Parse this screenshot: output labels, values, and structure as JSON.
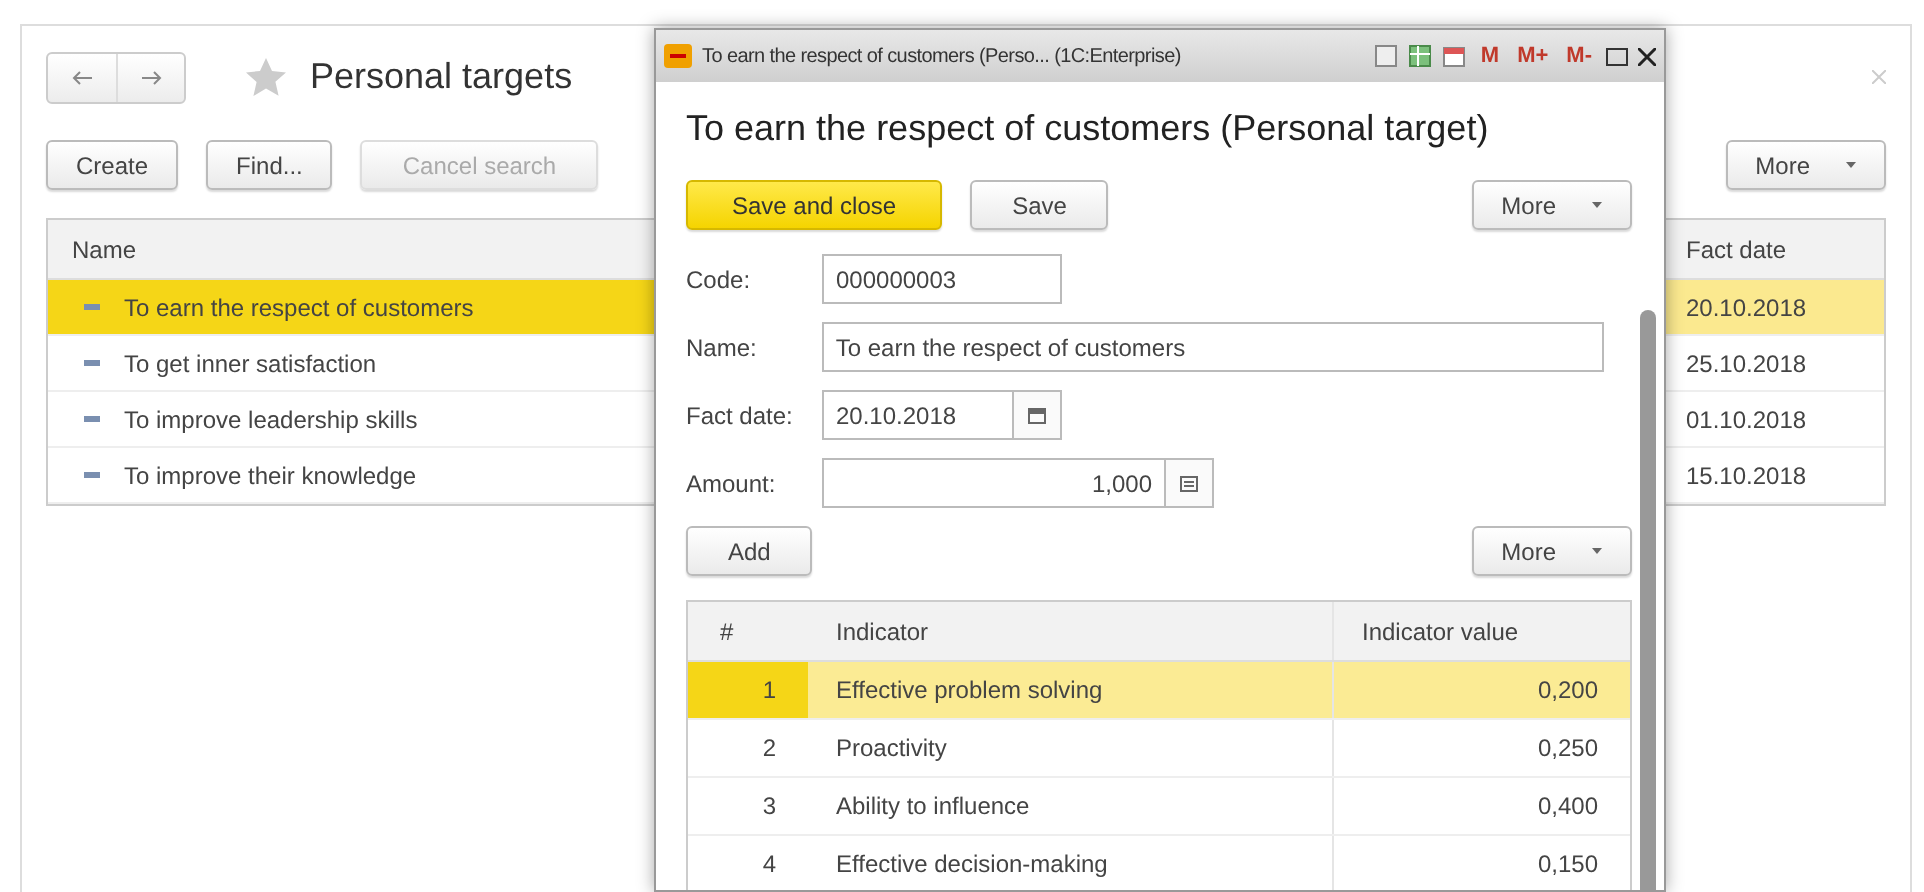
{
  "main": {
    "title": "Personal targets",
    "toolbar": [
      {
        "label": "Create",
        "disabled": false
      },
      {
        "label": "Find...",
        "disabled": false
      },
      {
        "label": "Cancel search",
        "disabled": true
      }
    ],
    "more": "More",
    "list": {
      "columns": [
        "Name",
        "Fact date"
      ],
      "rows": [
        {
          "name": "To earn the respect of customers",
          "fact_date": "20.10.2018",
          "selected": true
        },
        {
          "name": "To get inner satisfaction",
          "fact_date": "25.10.2018",
          "selected": false
        },
        {
          "name": "To improve leadership skills",
          "fact_date": "01.10.2018",
          "selected": false
        },
        {
          "name": "To improve their knowledge",
          "fact_date": "15.10.2018",
          "selected": false
        }
      ]
    }
  },
  "dialog": {
    "window_title": "To earn the respect of customers (Perso... (1C:Enterprise)",
    "memory_buttons": [
      "M",
      "M+",
      "M-"
    ],
    "heading": "To earn the respect of customers (Personal target)",
    "buttons": [
      {
        "label": "Save and close",
        "kind": "primary"
      },
      {
        "label": "Save",
        "kind": "plain"
      }
    ],
    "more": "More",
    "fields": [
      {
        "label": "Code:",
        "value": "000000003",
        "kind": "code"
      },
      {
        "label": "Name:",
        "value": "To earn the respect of customers",
        "kind": "text"
      },
      {
        "label": "Fact date:",
        "value": "20.10.2018",
        "kind": "date"
      },
      {
        "label": "Amount:",
        "value": "1,000",
        "kind": "number"
      }
    ],
    "table": {
      "add": "Add",
      "more": "More",
      "columns": [
        "#",
        "Indicator",
        "Indicator value"
      ],
      "rows": [
        {
          "num": "1",
          "indicator": "Effective problem solving",
          "value": "0,200",
          "selected": true
        },
        {
          "num": "2",
          "indicator": "Proactivity",
          "value": "0,250",
          "selected": false
        },
        {
          "num": "3",
          "indicator": "Ability to influence",
          "value": "0,400",
          "selected": false
        },
        {
          "num": "4",
          "indicator": "Effective decision-making",
          "value": "0,150",
          "selected": false
        }
      ]
    }
  }
}
